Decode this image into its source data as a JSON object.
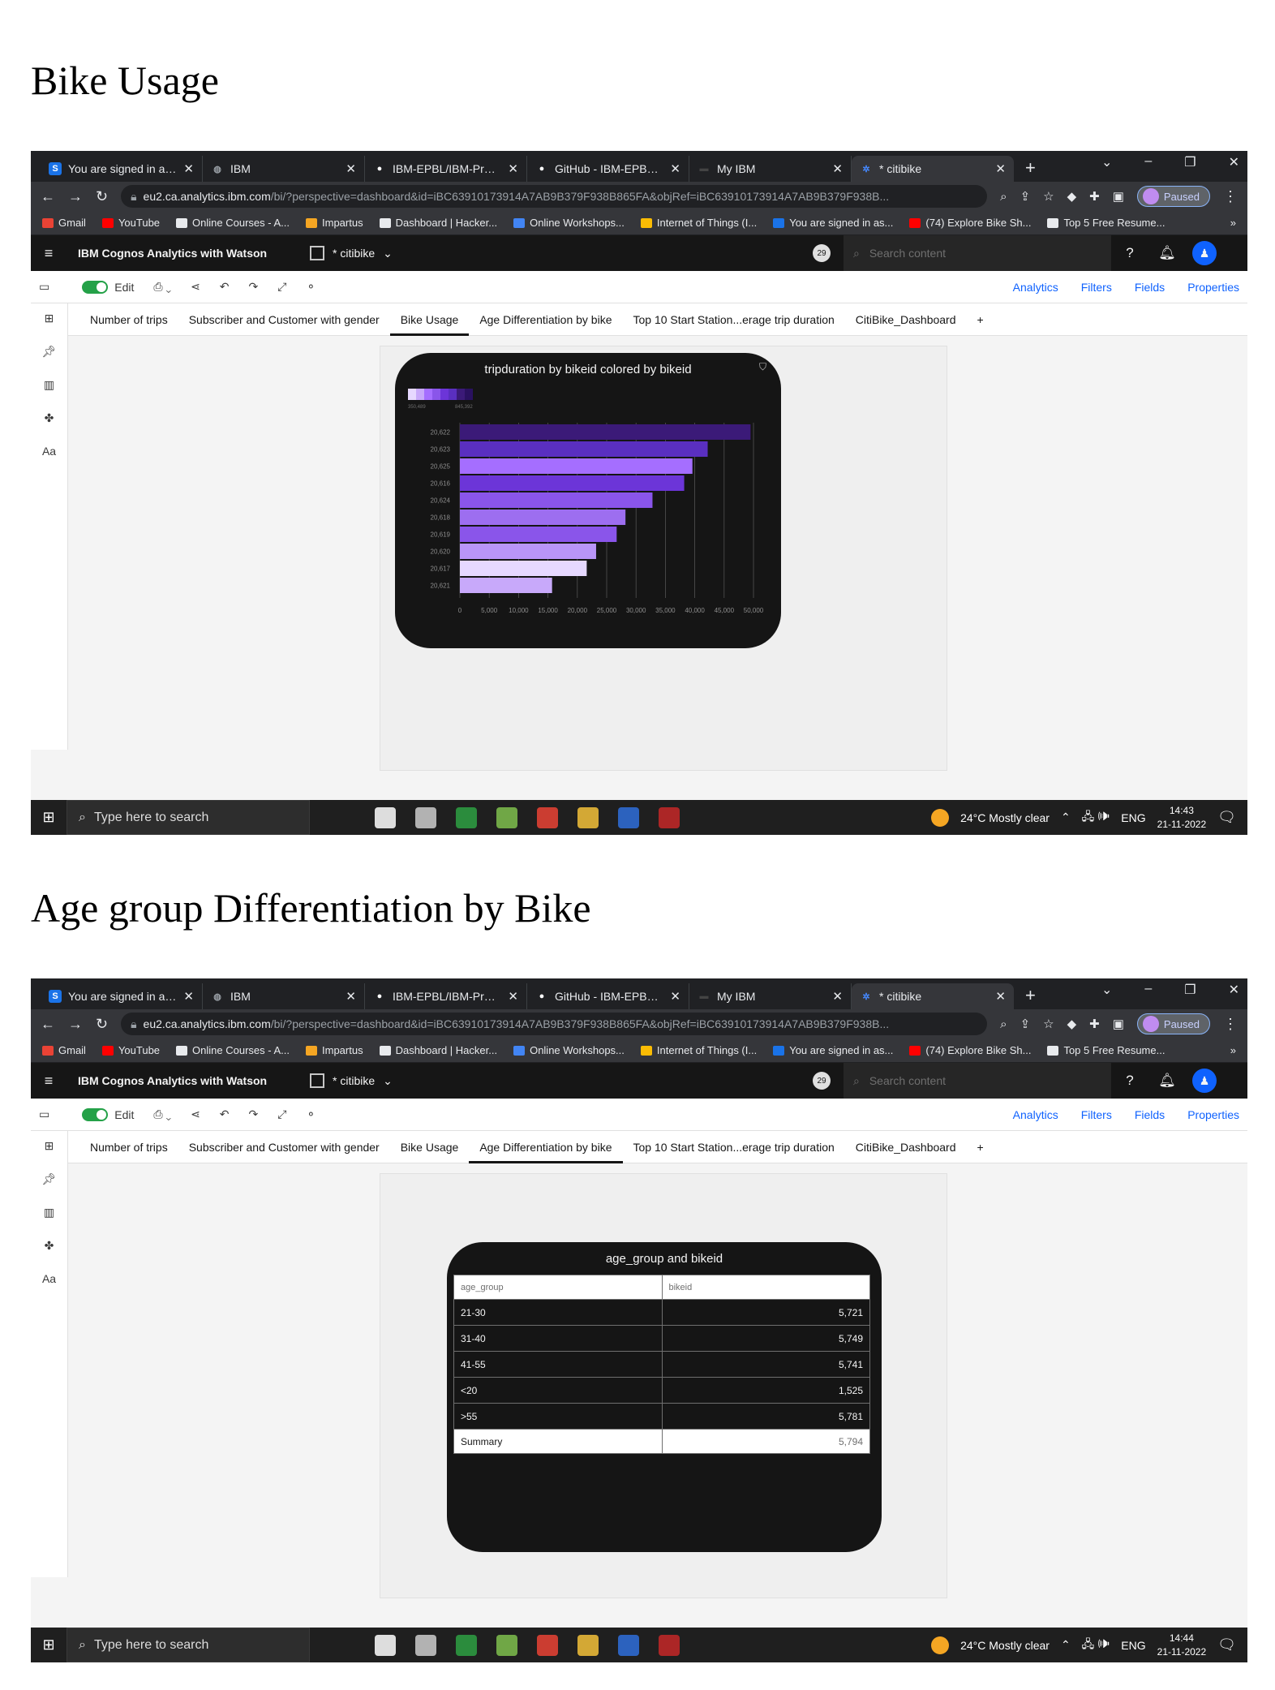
{
  "section1_heading": "Bike Usage",
  "section2_heading": "Age group Differentiation by Bike",
  "browser": {
    "tabs": [
      {
        "label": "You are signed in as 1",
        "icon": "S",
        "icon_color": "#1a73e8"
      },
      {
        "label": "IBM",
        "icon": "globe",
        "icon_color": "#9aa0a6"
      },
      {
        "label": "IBM-EPBL/IBM-Projec",
        "icon": "github",
        "icon_color": "#ffffff"
      },
      {
        "label": "GitHub - IBM-EPBL/IB",
        "icon": "github",
        "icon_color": "#ffffff"
      },
      {
        "label": "My IBM",
        "icon": "ibm",
        "icon_color": "#444"
      },
      {
        "label": "* citibike",
        "icon": "cognos",
        "icon_color": "#4589ff"
      }
    ],
    "url_host": "eu2.ca.analytics.ibm.com",
    "url_path": "/bi/?perspective=dashboard&id=iBC63910173914A7AB9B379F938B865FA&objRef=iBC63910173914A7AB9B379F938B...",
    "profile_status": "Paused",
    "bookmarks": [
      {
        "label": "Gmail",
        "color": "#ea4335"
      },
      {
        "label": "YouTube",
        "color": "#ff0000"
      },
      {
        "label": "Online Courses - A...",
        "color": "#e8eaed"
      },
      {
        "label": "Impartus",
        "color": "#f5a623"
      },
      {
        "label": "Dashboard | Hacker...",
        "color": "#e8eaed"
      },
      {
        "label": "Online Workshops...",
        "color": "#4285f4"
      },
      {
        "label": "Internet of Things (I...",
        "color": "#fbbc04"
      },
      {
        "label": "You are signed in as...",
        "color": "#1a73e8"
      },
      {
        "label": "(74) Explore Bike Sh...",
        "color": "#ff0000"
      },
      {
        "label": "Top 5 Free Resume...",
        "color": "#e8eaed"
      }
    ],
    "more_bookmarks": "»"
  },
  "app": {
    "brand": "IBM Cognos Analytics with Watson",
    "report_name": "* citibike",
    "notification_count": "29",
    "search_placeholder": "Search content",
    "edit_label": "Edit",
    "right_tools": [
      "Analytics",
      "Filters",
      "Fields",
      "Properties"
    ],
    "dashboard_tabs": [
      "Number of trips",
      "Subscriber and Customer with gender",
      "Bike Usage",
      "Age Differentiation by bike",
      "Top 10 Start Station...erage trip duration",
      "CitiBike_Dashboard",
      "+"
    ]
  },
  "shot1": {
    "active_tab_index": 2,
    "card_title": "tripduration by bikeid colored by bikeid",
    "legend_min": "350,489",
    "legend_max": "845,392",
    "time": "14:43",
    "date": "21-11-2022"
  },
  "shot2": {
    "active_tab_index": 3,
    "card_title": "age_group and bikeid",
    "table": {
      "columns": [
        "age_group",
        "bikeid"
      ],
      "rows": [
        [
          "21-30",
          "5,721"
        ],
        [
          "31-40",
          "5,749"
        ],
        [
          "41-55",
          "5,741"
        ],
        [
          "<20",
          "1,525"
        ],
        [
          ">55",
          "5,781"
        ]
      ],
      "summary": [
        "Summary",
        "5,794"
      ]
    },
    "time": "14:44",
    "date": "21-11-2022"
  },
  "taskbar": {
    "search_placeholder": "Type here to search",
    "weather": "24°C  Mostly clear",
    "lang": "ENG"
  },
  "chart_data": {
    "type": "bar",
    "orientation": "horizontal",
    "title": "tripduration by bikeid colored by bikeid",
    "categories": [
      "20,622",
      "20,623",
      "20,625",
      "20,616",
      "20,624",
      "20,618",
      "20,619",
      "20,620",
      "20,617",
      "20,621"
    ],
    "values": [
      49500,
      42200,
      39600,
      38200,
      32800,
      28200,
      26700,
      23200,
      21600,
      15700
    ],
    "colors": [
      "#3b1a78",
      "#5a2fc0",
      "#a56eff",
      "#6c35d8",
      "#8a55ea",
      "#9d6ef0",
      "#8a55ea",
      "#b995f8",
      "#e6d8ff",
      "#c8a9fa"
    ],
    "xticks": [
      "0",
      "5,000",
      "10,000",
      "15,000",
      "20,000",
      "25,000",
      "30,000",
      "35,000",
      "40,000",
      "45,000",
      "50,000"
    ],
    "xlim": [
      0,
      50000
    ],
    "grid": true,
    "legend": "top-left"
  }
}
